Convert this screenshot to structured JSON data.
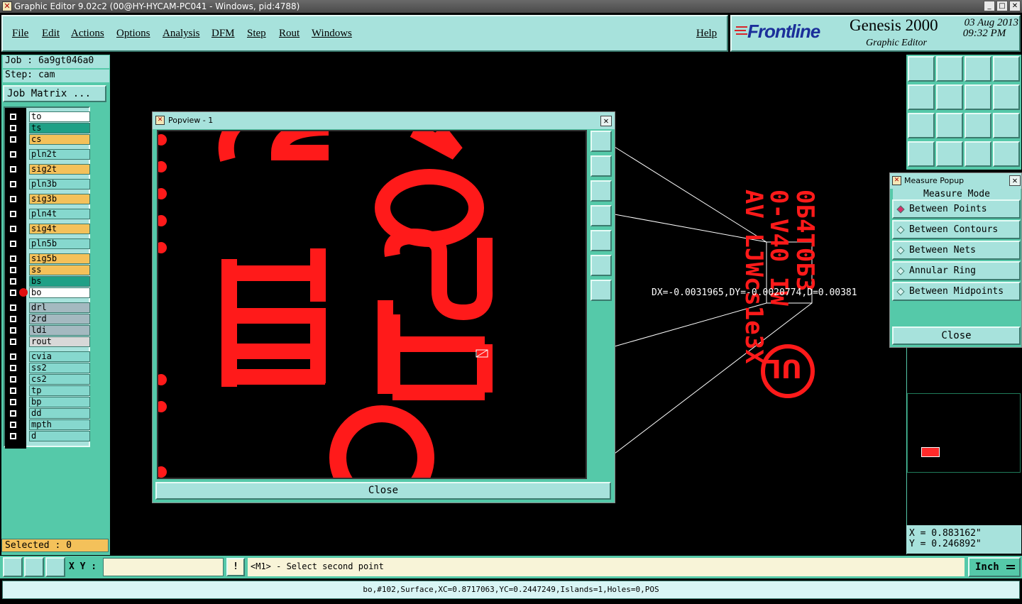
{
  "window": {
    "title": "Graphic Editor 9.02c2 (00@HY-HYCAM-PC041 - Windows, pid:4788)"
  },
  "menu": {
    "items": [
      "File",
      "Edit",
      "Actions",
      "Options",
      "Analysis",
      "DFM",
      "Step",
      "Rout",
      "Windows"
    ],
    "help": "Help"
  },
  "brand": {
    "logo": "Frontline",
    "product": "Genesis 2000",
    "subtitle": "Graphic Editor",
    "date": "03 Aug 2013",
    "time": "09:32 PM"
  },
  "job": {
    "job_label": "Job : 6a9gt046a0",
    "step_label": "Step: cam",
    "matrix_button": "Job Matrix ..."
  },
  "layers": [
    {
      "name": "to",
      "color": "#ffffff"
    },
    {
      "name": "ts",
      "color": "#1fa086"
    },
    {
      "name": "cs",
      "color": "#f4c15a"
    },
    {
      "name": "pln2t",
      "color": "#86d8ce"
    },
    {
      "name": "sig2t",
      "color": "#f4c15a"
    },
    {
      "name": "pln3b",
      "color": "#86d8ce"
    },
    {
      "name": "sig3b",
      "color": "#f4c15a"
    },
    {
      "name": "pln4t",
      "color": "#86d8ce"
    },
    {
      "name": "sig4t",
      "color": "#f4c15a"
    },
    {
      "name": "pln5b",
      "color": "#86d8ce"
    },
    {
      "name": "sig5b",
      "color": "#f4c15a"
    },
    {
      "name": "ss",
      "color": "#f4c15a"
    },
    {
      "name": "bs",
      "color": "#1fa086"
    },
    {
      "name": "bo",
      "color": "#ffffff"
    },
    {
      "name": "drl",
      "color": "#a4b9c0"
    },
    {
      "name": "2rd",
      "color": "#a4b9c0"
    },
    {
      "name": "ldi",
      "color": "#a4b9c0"
    },
    {
      "name": "rout",
      "color": "#d8d8d8"
    },
    {
      "name": "cvia",
      "color": "#86d8ce"
    },
    {
      "name": "ss2",
      "color": "#86d8ce"
    },
    {
      "name": "cs2",
      "color": "#86d8ce"
    },
    {
      "name": "tp",
      "color": "#86d8ce"
    },
    {
      "name": "bp",
      "color": "#86d8ce"
    },
    {
      "name": "dd",
      "color": "#86d8ce"
    },
    {
      "name": "mpth",
      "color": "#86d8ce"
    },
    {
      "name": "d",
      "color": "#86d8ce"
    }
  ],
  "selected": "Selected : 0",
  "popview": {
    "title": "Popview - 1",
    "close": "Close",
    "close_x": "✕"
  },
  "measure": {
    "title": "Measure Popup",
    "mode_label": "Measure Mode",
    "options": [
      "Between Points",
      "Between Contours",
      "Between Nets",
      "Annular Ring",
      "Between Midpoints"
    ],
    "selected_option": "Between Points",
    "close": "Close"
  },
  "canvas": {
    "readout": "DX=-0.0031965,DY=-0.0020774,D=0.00381",
    "board_texts": [
      "0Б4Т0Б3",
      "0-V40 IW",
      "AV LJWcs1e3X"
    ]
  },
  "coords": {
    "x": "X = 0.883162\"",
    "y": "Y = 0.246892\""
  },
  "bottom": {
    "xy_label": "X Y :",
    "xy_value": "",
    "alert": "!",
    "prompt": "<M1> - Select second point",
    "units": "Inch",
    "status": "bo,#102,Surface,XC=0.8717063,YC=0.2447249,Islands=1,Holes=0,POS"
  },
  "colors": {
    "panel": "#55c9a9",
    "panel_light": "#a7e2dc",
    "feature": "#ff0000",
    "accent": "#f4c15a"
  }
}
